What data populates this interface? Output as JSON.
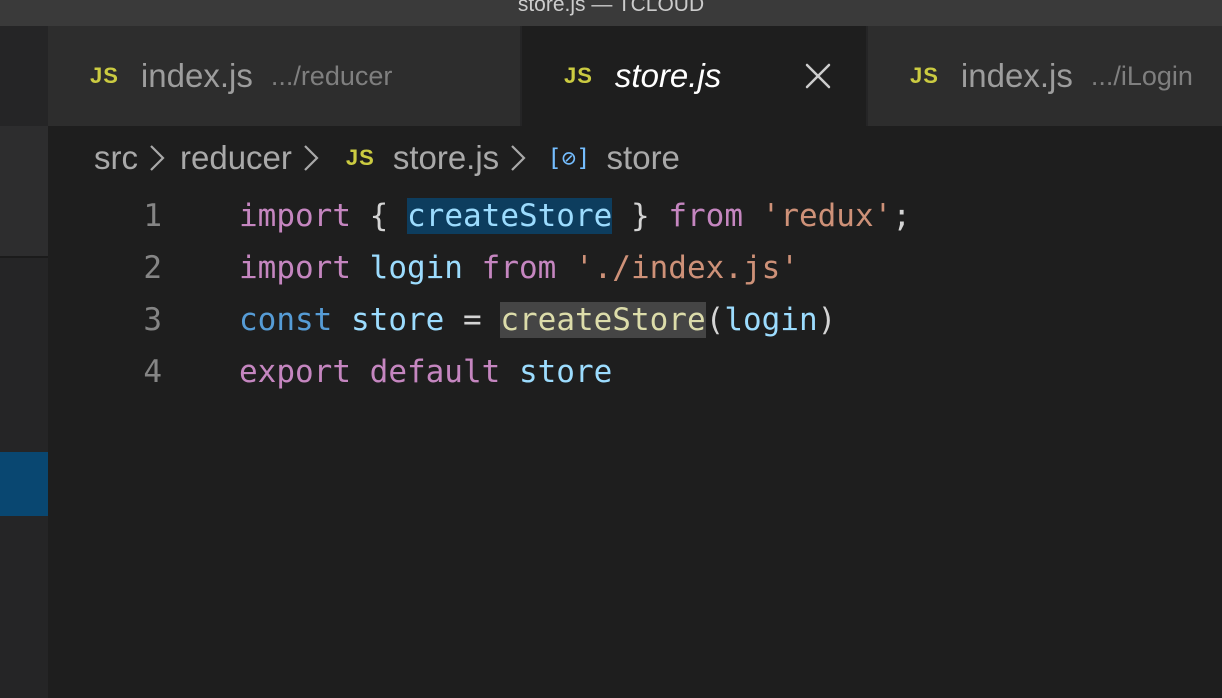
{
  "window": {
    "title": "store.js — TCLOUD"
  },
  "tabs": [
    {
      "icon": "JS",
      "name": "index.js",
      "description": ".../reducer",
      "active": false
    },
    {
      "icon": "JS",
      "name": "store.js",
      "description": "",
      "active": true,
      "close_icon": "close-icon"
    },
    {
      "icon": "JS",
      "name": "index.js",
      "description": ".../iLogin",
      "active": false
    }
  ],
  "breadcrumb": {
    "items": [
      "src",
      "reducer",
      "store.js",
      "store"
    ],
    "file_icon": "JS",
    "symbol_icon": "[⊘]",
    "separator_icon": "chevron-right-icon"
  },
  "editor": {
    "lines": [
      {
        "number": "1",
        "tokens": [
          {
            "text": "import",
            "kind": "kw-purple"
          },
          {
            "text": " ",
            "kind": "punc"
          },
          {
            "text": "{",
            "kind": "punc"
          },
          {
            "text": " ",
            "kind": "punc"
          },
          {
            "text": "createStore",
            "kind": "ident",
            "highlight": "selection"
          },
          {
            "text": " ",
            "kind": "punc"
          },
          {
            "text": "}",
            "kind": "punc"
          },
          {
            "text": " ",
            "kind": "punc"
          },
          {
            "text": "from",
            "kind": "kw-purple"
          },
          {
            "text": " ",
            "kind": "punc"
          },
          {
            "text": "'redux'",
            "kind": "str"
          },
          {
            "text": ";",
            "kind": "punc"
          }
        ]
      },
      {
        "number": "2",
        "tokens": [
          {
            "text": "import",
            "kind": "kw-purple"
          },
          {
            "text": " ",
            "kind": "punc"
          },
          {
            "text": "login",
            "kind": "ident"
          },
          {
            "text": " ",
            "kind": "punc"
          },
          {
            "text": "from",
            "kind": "kw-purple"
          },
          {
            "text": " ",
            "kind": "punc"
          },
          {
            "text": "'./index.js'",
            "kind": "str"
          }
        ]
      },
      {
        "number": "3",
        "tokens": [
          {
            "text": "const",
            "kind": "kw-blue"
          },
          {
            "text": " ",
            "kind": "punc"
          },
          {
            "text": "store",
            "kind": "ident"
          },
          {
            "text": " = ",
            "kind": "punc"
          },
          {
            "text": "createStore",
            "kind": "fn",
            "highlight": "box"
          },
          {
            "text": "(",
            "kind": "punc"
          },
          {
            "text": "login",
            "kind": "ident"
          },
          {
            "text": ")",
            "kind": "punc"
          }
        ]
      },
      {
        "number": "4",
        "tokens": [
          {
            "text": "export",
            "kind": "kw-purple"
          },
          {
            "text": " ",
            "kind": "punc"
          },
          {
            "text": "default",
            "kind": "kw-purple"
          },
          {
            "text": " ",
            "kind": "punc"
          },
          {
            "text": "store",
            "kind": "ident"
          }
        ]
      }
    ]
  },
  "colors": {
    "editor_bg": "#1e1e1e",
    "tab_inactive_bg": "#2d2d2d",
    "js_icon": "#cbcb41",
    "keyword_purple": "#c586c0",
    "keyword_blue": "#569cd6",
    "identifier": "#9cdcfe",
    "function": "#dcdcaa",
    "string": "#ce9178",
    "selection_highlight": "#0d3d5e",
    "sidebar_active": "#094771"
  }
}
